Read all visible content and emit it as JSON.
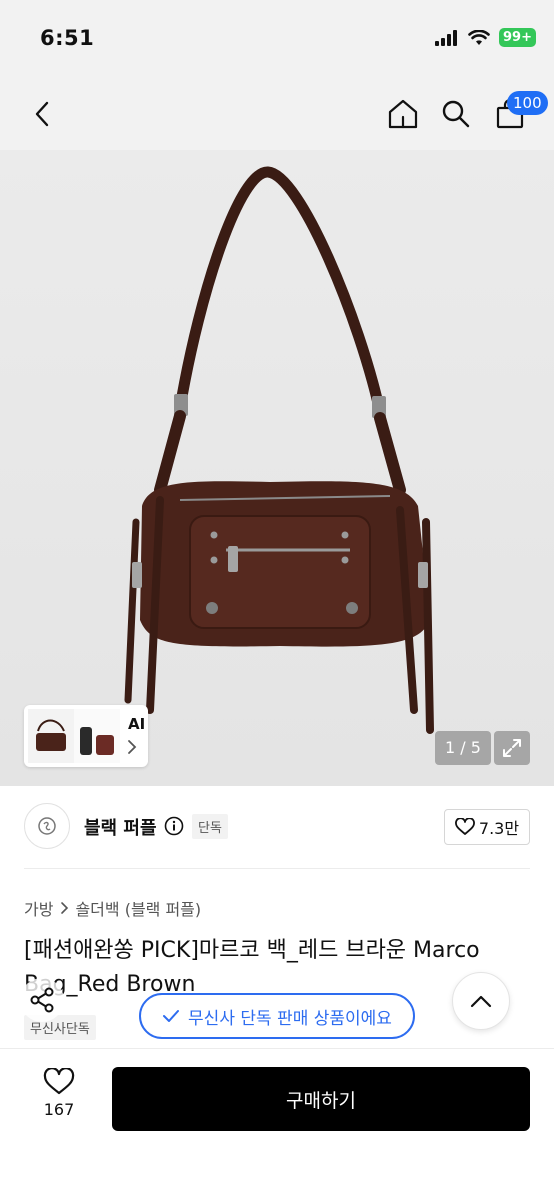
{
  "status_bar": {
    "time": "6:51",
    "battery": "99+"
  },
  "nav": {
    "cart_count": "100"
  },
  "gallery": {
    "counter": "1 / 5",
    "ai_label": "AI"
  },
  "brand": {
    "name": "블랙 퍼플",
    "exclusive_tag": "단독",
    "likes": "7.3만"
  },
  "breadcrumb": {
    "category": "가방",
    "subcategory": "숄더백 (블랙 퍼플)"
  },
  "product": {
    "title": "[패션애완쏭 PICK]마르코 백_레드 브라운 Marco Bag_Red Brown",
    "tag": "무신사단독"
  },
  "floating": {
    "exclusive_text": "무신사 단독 판매 상품이에요"
  },
  "bottom": {
    "wish_count": "167",
    "buy_label": "구매하기"
  },
  "colors": {
    "accent": "#2d6cf0",
    "badge": "#1f6ef5",
    "buy": "#000000",
    "bag": "#4a231a"
  }
}
